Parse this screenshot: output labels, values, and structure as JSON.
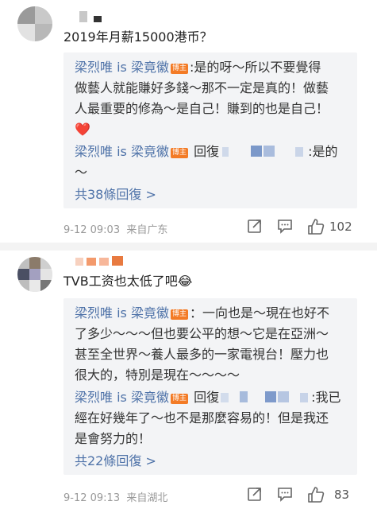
{
  "comments": [
    {
      "text": "2019年月薪15000港币？",
      "replies": [
        {
          "line1_name": "梁烈唯 is 梁竟徽",
          "badge": "博主",
          "line1_text": ":是的呀～所以不要覺得",
          "line2": "做藝人就能賺好多錢～那不一定是真的！做藝",
          "line3": "人最重要的修為～是自己！賺到的也是自己！",
          "emoji": "❤️"
        },
        {
          "name": "梁烈唯 is 梁竟徽",
          "badge": "博主",
          "prefix": "回復",
          "suffix": ":是的",
          "line2": "～"
        }
      ],
      "more_replies": "共38條回復 >",
      "date": "9-12 09:03",
      "source": "来自广东",
      "likes": "102"
    },
    {
      "text": "TVB工资也太低了吧",
      "emoji": "😂",
      "replies": [
        {
          "line1_name": "梁烈唯 is 梁竟徽",
          "badge": "博主",
          "line1_text": "：一向也是～現在也好不",
          "line2": "了多少～～～但也要公平的想～它是在亞洲～",
          "line3": "甚至全世界～養人最多的一家電視台！壓力也",
          "line4": "很大的，特別是現在～～～～"
        },
        {
          "name": "梁烈唯 is 梁竟徽",
          "badge": "博主",
          "prefix": "回復",
          "suffix": ":我已",
          "line2": "經在好幾年了～也不是那麼容易的！但是我还",
          "line3": "是會努力的！"
        }
      ],
      "more_replies": "共22條回復 >",
      "date": "9-12 09:13",
      "source": "来自湖北",
      "likes": "83"
    }
  ],
  "icons": [
    "share-icon",
    "comment-icon",
    "like-icon"
  ],
  "colors": {
    "link": "#4e72a8",
    "badge": "#f37b26",
    "reply_bg": "#f3f4f6",
    "divider": "#f3f3f3"
  }
}
